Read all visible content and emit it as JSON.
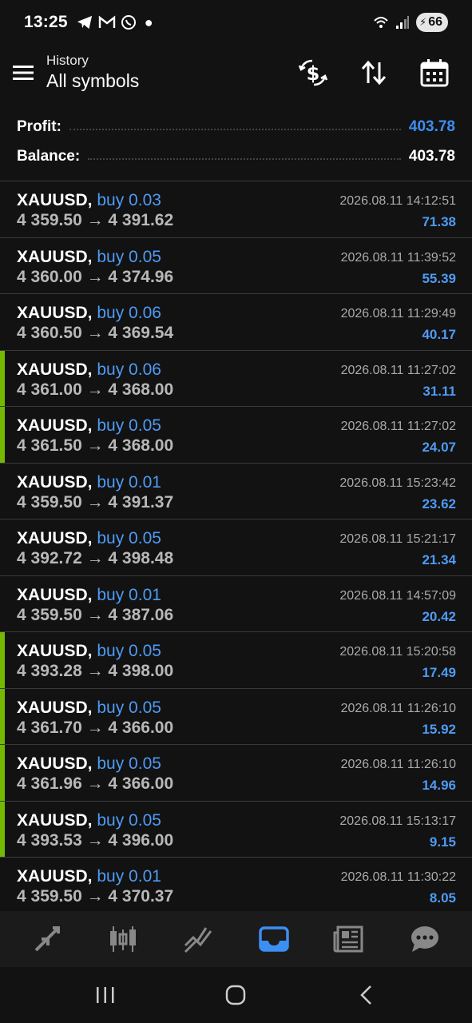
{
  "status": {
    "time": "13:25",
    "battery": "66"
  },
  "header": {
    "subtitle": "History",
    "title": "All symbols"
  },
  "summary": {
    "profit_label": "Profit:",
    "profit_value": "403.78",
    "balance_label": "Balance:",
    "balance_value": "403.78"
  },
  "deals": [
    {
      "symbol": "XAUUSD,",
      "side": "buy 0.03",
      "prices": "4 359.50 → 4 391.62",
      "time": "2026.08.11 14:12:51",
      "profit": "71.38",
      "marked": false
    },
    {
      "symbol": "XAUUSD,",
      "side": "buy 0.05",
      "prices": "4 360.00 → 4 374.96",
      "time": "2026.08.11 11:39:52",
      "profit": "55.39",
      "marked": false
    },
    {
      "symbol": "XAUUSD,",
      "side": "buy 0.06",
      "prices": "4 360.50 → 4 369.54",
      "time": "2026.08.11 11:29:49",
      "profit": "40.17",
      "marked": false
    },
    {
      "symbol": "XAUUSD,",
      "side": "buy 0.06",
      "prices": "4 361.00 → 4 368.00",
      "time": "2026.08.11 11:27:02",
      "profit": "31.11",
      "marked": true
    },
    {
      "symbol": "XAUUSD,",
      "side": "buy 0.05",
      "prices": "4 361.50 → 4 368.00",
      "time": "2026.08.11 11:27:02",
      "profit": "24.07",
      "marked": true
    },
    {
      "symbol": "XAUUSD,",
      "side": "buy 0.01",
      "prices": "4 359.50 → 4 391.37",
      "time": "2026.08.11 15:23:42",
      "profit": "23.62",
      "marked": false
    },
    {
      "symbol": "XAUUSD,",
      "side": "buy 0.05",
      "prices": "4 392.72 → 4 398.48",
      "time": "2026.08.11 15:21:17",
      "profit": "21.34",
      "marked": false
    },
    {
      "symbol": "XAUUSD,",
      "side": "buy 0.01",
      "prices": "4 359.50 → 4 387.06",
      "time": "2026.08.11 14:57:09",
      "profit": "20.42",
      "marked": false
    },
    {
      "symbol": "XAUUSD,",
      "side": "buy 0.05",
      "prices": "4 393.28 → 4 398.00",
      "time": "2026.08.11 15:20:58",
      "profit": "17.49",
      "marked": true
    },
    {
      "symbol": "XAUUSD,",
      "side": "buy 0.05",
      "prices": "4 361.70 → 4 366.00",
      "time": "2026.08.11 11:26:10",
      "profit": "15.92",
      "marked": true
    },
    {
      "symbol": "XAUUSD,",
      "side": "buy 0.05",
      "prices": "4 361.96 → 4 366.00",
      "time": "2026.08.11 11:26:10",
      "profit": "14.96",
      "marked": true
    },
    {
      "symbol": "XAUUSD,",
      "side": "buy 0.05",
      "prices": "4 393.53 → 4 396.00",
      "time": "2026.08.11 15:13:17",
      "profit": "9.15",
      "marked": true
    },
    {
      "symbol": "XAUUSD,",
      "side": "buy 0.01",
      "prices": "4 359.50 → 4 370.37",
      "time": "2026.08.11 11:30:22",
      "profit": "8.05",
      "marked": false
    }
  ],
  "bottom_nav": {
    "active": "history",
    "items": [
      "quotes-icon",
      "chart-icon",
      "trade-icon",
      "history-icon",
      "news-icon",
      "chat-icon"
    ]
  },
  "colors": {
    "background": "#121212",
    "accent_blue": "#4e9bf5",
    "marker_green": "#74b800",
    "nav_active": "#3d8ef2"
  }
}
